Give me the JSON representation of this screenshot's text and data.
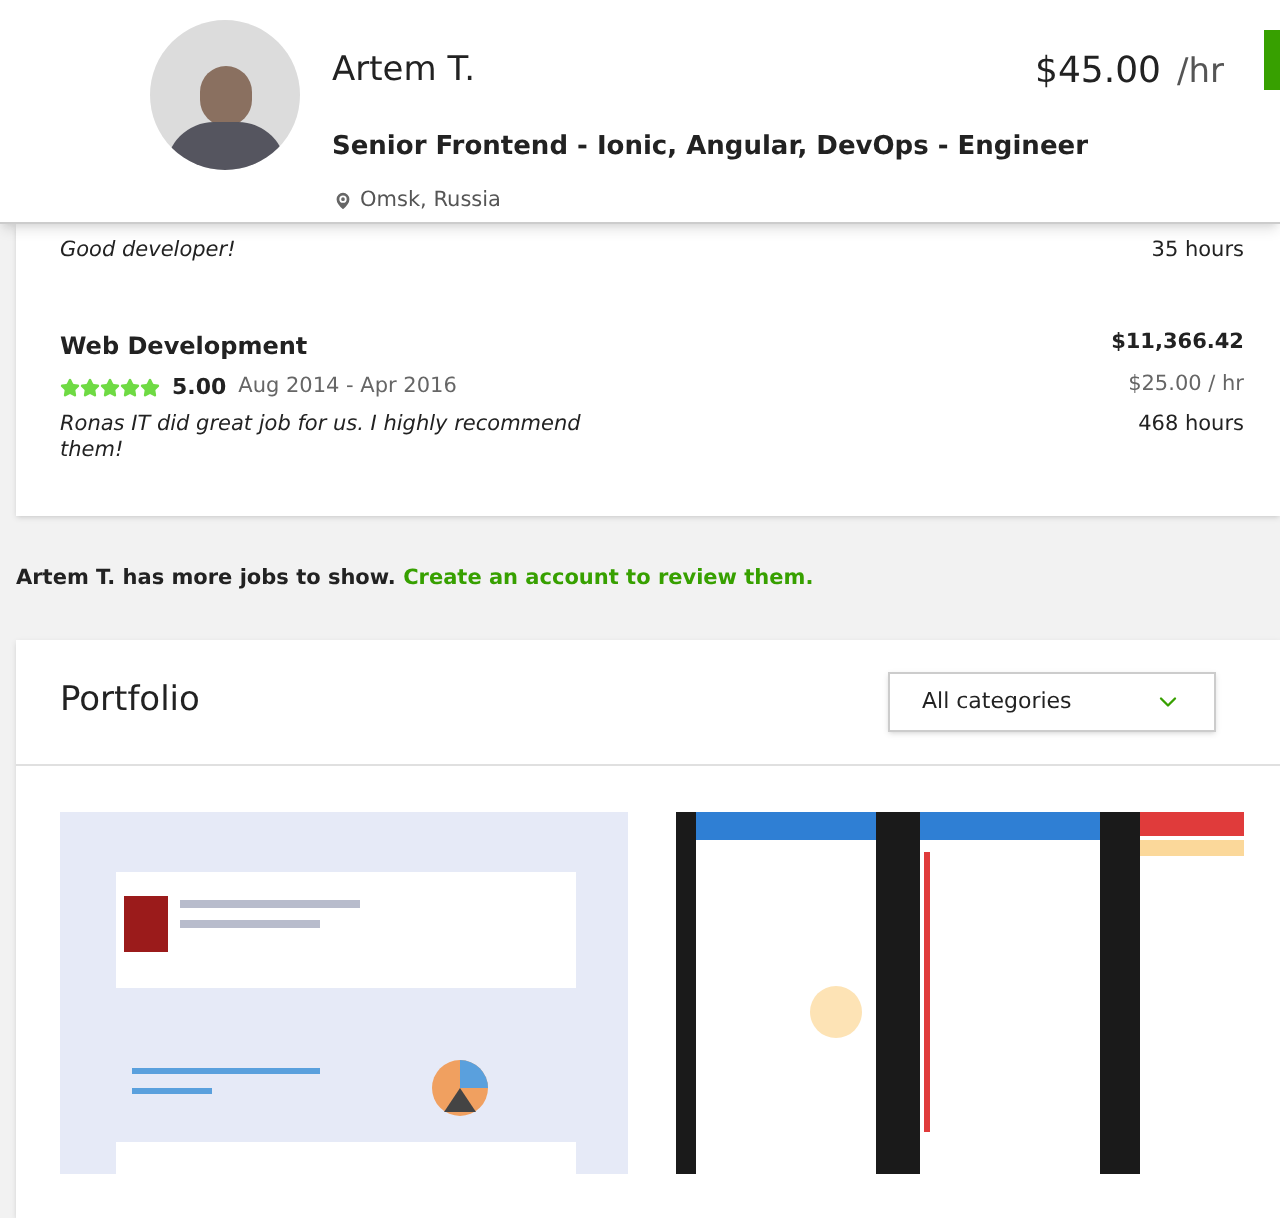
{
  "profile": {
    "name": "Artem T.",
    "title": "Senior Frontend - Ionic, Angular, DevOps - Engineer",
    "location": "Omsk, Russia",
    "rate": "$45.00",
    "rate_unit": "/hr"
  },
  "jobs": [
    {
      "comment": "Good developer!",
      "hours": "35 hours"
    },
    {
      "title": "Web Development",
      "stars": 5,
      "score": "5.00",
      "dates": "Aug 2014 - Apr 2016",
      "comment": "Ronas IT did great job for us. I highly recommend them!",
      "earned": "$11,366.42",
      "rate": "$25.00 / hr",
      "hours": "468 hours"
    }
  ],
  "more_jobs": {
    "text": "Artem T. has more jobs to show.",
    "link": "Create an account to review them."
  },
  "portfolio": {
    "title": "Portfolio",
    "filter": "All categories"
  }
}
